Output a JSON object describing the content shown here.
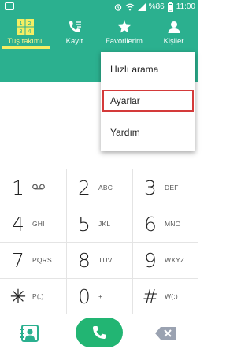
{
  "status_bar": {
    "battery_text": "%86",
    "time": "11:00"
  },
  "tabs": [
    {
      "label": "Tuş takımı",
      "icon": "dialpad-icon",
      "active": true
    },
    {
      "label": "Kayıt",
      "icon": "call-log-icon",
      "active": false
    },
    {
      "label": "Favorilerim",
      "icon": "star-icon",
      "active": false
    },
    {
      "label": "Kişiler",
      "icon": "contacts-icon",
      "active": false
    }
  ],
  "menu": {
    "items": [
      "Hızlı arama",
      "Ayarlar",
      "Yardım"
    ],
    "highlighted": "Ayarlar"
  },
  "keypad": {
    "keys": [
      {
        "digit": "1",
        "letters": "",
        "icon": "voicemail-icon"
      },
      {
        "digit": "2",
        "letters": "ABC"
      },
      {
        "digit": "3",
        "letters": "DEF"
      },
      {
        "digit": "4",
        "letters": "GHI"
      },
      {
        "digit": "5",
        "letters": "JKL"
      },
      {
        "digit": "6",
        "letters": "MNO"
      },
      {
        "digit": "7",
        "letters": "PQRS"
      },
      {
        "digit": "8",
        "letters": "TUV"
      },
      {
        "digit": "9",
        "letters": "WXYZ"
      },
      {
        "digit": "✳",
        "letters": "P(,)"
      },
      {
        "digit": "0",
        "letters": "+"
      },
      {
        "digit": "#",
        "letters": "W(;)"
      }
    ]
  },
  "colors": {
    "header": "#2bb08f",
    "active_tab_indicator": "#f5ee63",
    "call_button": "#22b573",
    "highlight_border": "#d43a3a"
  }
}
